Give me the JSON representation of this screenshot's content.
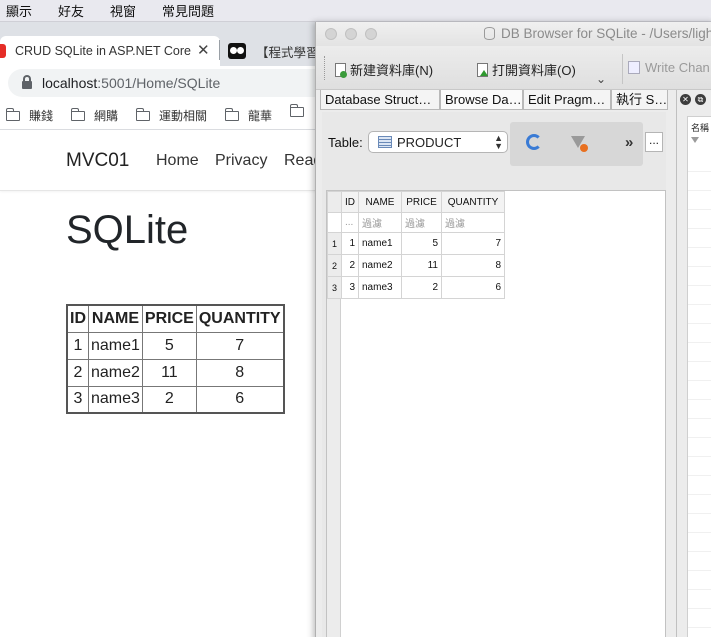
{
  "menubar": {
    "items": [
      "顯示",
      "好友",
      "視窗",
      "常見問題"
    ]
  },
  "browser": {
    "tab_active": {
      "title": "CRUD SQLite in ASP.NET Core"
    },
    "tab_second": {
      "title": "【程式學習"
    },
    "address": {
      "host": "localhost",
      "path": ":5001/Home/SQLite"
    },
    "bookmarks": [
      "賺錢",
      "網購",
      "運動相關",
      "龍華"
    ]
  },
  "site": {
    "brand": "MVC01",
    "nav": [
      "Home",
      "Privacy",
      "Read"
    ],
    "heading": "SQLite",
    "table": {
      "columns": [
        "ID",
        "NAME",
        "PRICE",
        "QUANTITY"
      ],
      "rows": [
        [
          "1",
          "name1",
          "5",
          "7"
        ],
        [
          "2",
          "name2",
          "11",
          "8"
        ],
        [
          "3",
          "name3",
          "2",
          "6"
        ]
      ]
    }
  },
  "dbbrowser": {
    "title": "DB Browser for SQLite - /Users/ligh",
    "toolbar": {
      "new_db": "新建資料庫(N)",
      "open_db": "打開資料庫(O)",
      "write_changes": "Write Chan"
    },
    "tabs": [
      "Database Struct…",
      "Browse Da…",
      "Edit Pragm…",
      "執行 S…"
    ],
    "table_label": "Table:",
    "table_selected": "PRODUCT",
    "more_label": "...",
    "grid": {
      "columns": [
        "ID",
        "NAME",
        "PRICE",
        "QUANTITY"
      ],
      "filter_placeholder": "過濾",
      "filter_id": "...",
      "rows": [
        {
          "rownum": "1",
          "cells": [
            "1",
            "name1",
            "5",
            "7"
          ]
        },
        {
          "rownum": "2",
          "cells": [
            "2",
            "name2",
            "11",
            "8"
          ]
        },
        {
          "rownum": "3",
          "cells": [
            "3",
            "name3",
            "2",
            "6"
          ]
        }
      ]
    },
    "right_panel": {
      "header": "名稱"
    }
  }
}
